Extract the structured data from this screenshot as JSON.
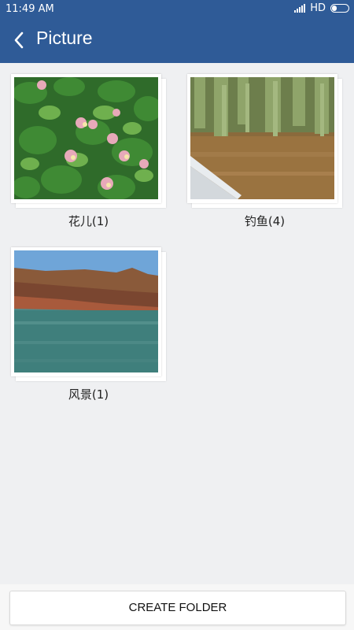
{
  "status_bar": {
    "time": "11:49 AM",
    "network": "HD"
  },
  "header": {
    "title": "Picture",
    "back_icon": "chevron-left-icon"
  },
  "folders": [
    {
      "label": "花儿(1)"
    },
    {
      "label": "钓鱼(4)"
    },
    {
      "label": "风景(1)"
    }
  ],
  "footer": {
    "create_folder_label": "CREATE FOLDER"
  },
  "colors": {
    "header_bg": "#2f5b97",
    "page_bg": "#eff0f2"
  }
}
